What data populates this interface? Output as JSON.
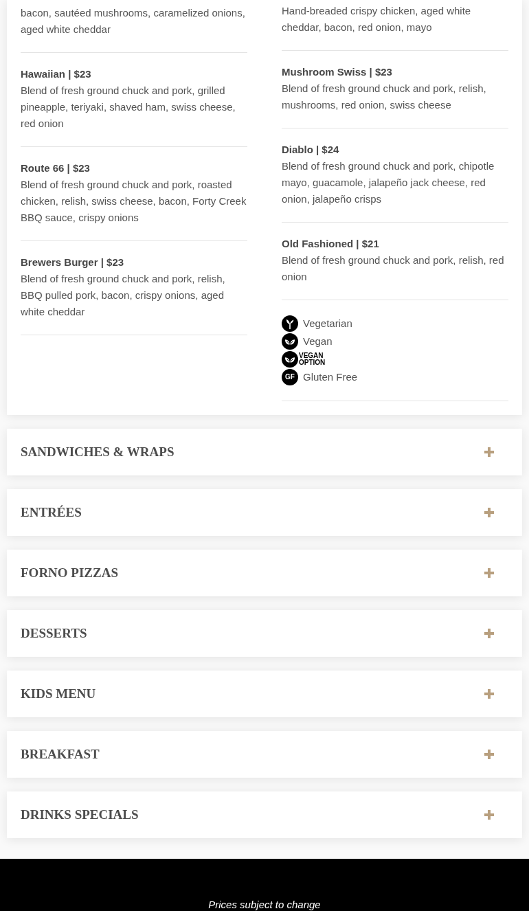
{
  "menu_panel": {
    "columns": [
      {
        "items": [
          {
            "description": "bacon, sautéed mushrooms, caramelized onions, aged white cheddar"
          },
          {
            "title": "Hawaiian | $23",
            "description": "Blend of fresh ground chuck and pork, grilled pineapple, teriyaki, shaved ham, swiss cheese, red onion"
          },
          {
            "title": "Route 66 | $23",
            "description": "Blend of fresh ground chuck and pork, roasted chicken, relish, swiss cheese, bacon, Forty Creek BBQ sauce, crispy onions"
          },
          {
            "title": "Brewers Burger | $23",
            "description": "Blend of fresh ground chuck and pork, relish, BBQ pulled pork, bacon, crispy onions, aged white cheddar"
          }
        ]
      },
      {
        "items": [
          {
            "description": "Hand-breaded crispy chicken, aged white cheddar, bacon, red onion, mayo"
          },
          {
            "title": "Mushroom Swiss | $23",
            "description": "Blend of fresh ground chuck and pork, relish, mushrooms, red onion, swiss cheese"
          },
          {
            "title": "Diablo | $24",
            "description": "Blend of fresh ground chuck and pork, chipotle mayo, guacamole, jalapeño jack cheese, red onion, jalapeño crisps"
          },
          {
            "title": "Old Fashioned | $21",
            "description": "Blend of fresh ground chuck and pork, relish, red onion"
          }
        ],
        "legend": [
          {
            "kind": "vegetarian",
            "label": "Vegetarian"
          },
          {
            "kind": "vegan",
            "label": "Vegan"
          },
          {
            "kind": "vegan_option",
            "label": "VEGAN OPTION"
          },
          {
            "kind": "gluten_free",
            "icon_text": "GF",
            "label": "Gluten Free"
          }
        ]
      }
    ]
  },
  "sections": [
    {
      "title": "SANDWICHES & WRAPS",
      "expanded": false
    },
    {
      "title": "ENTRÉES",
      "expanded": false
    },
    {
      "title": "FORNO PIZZAS",
      "expanded": false
    },
    {
      "title": "DESSERTS",
      "expanded": false
    },
    {
      "title": "KIDS MENU",
      "expanded": false
    },
    {
      "title": "BREAKFAST",
      "expanded": false
    },
    {
      "title": "DRINKS SPECIALS",
      "expanded": false
    }
  ],
  "footer": {
    "note": "Prices subject to change"
  }
}
